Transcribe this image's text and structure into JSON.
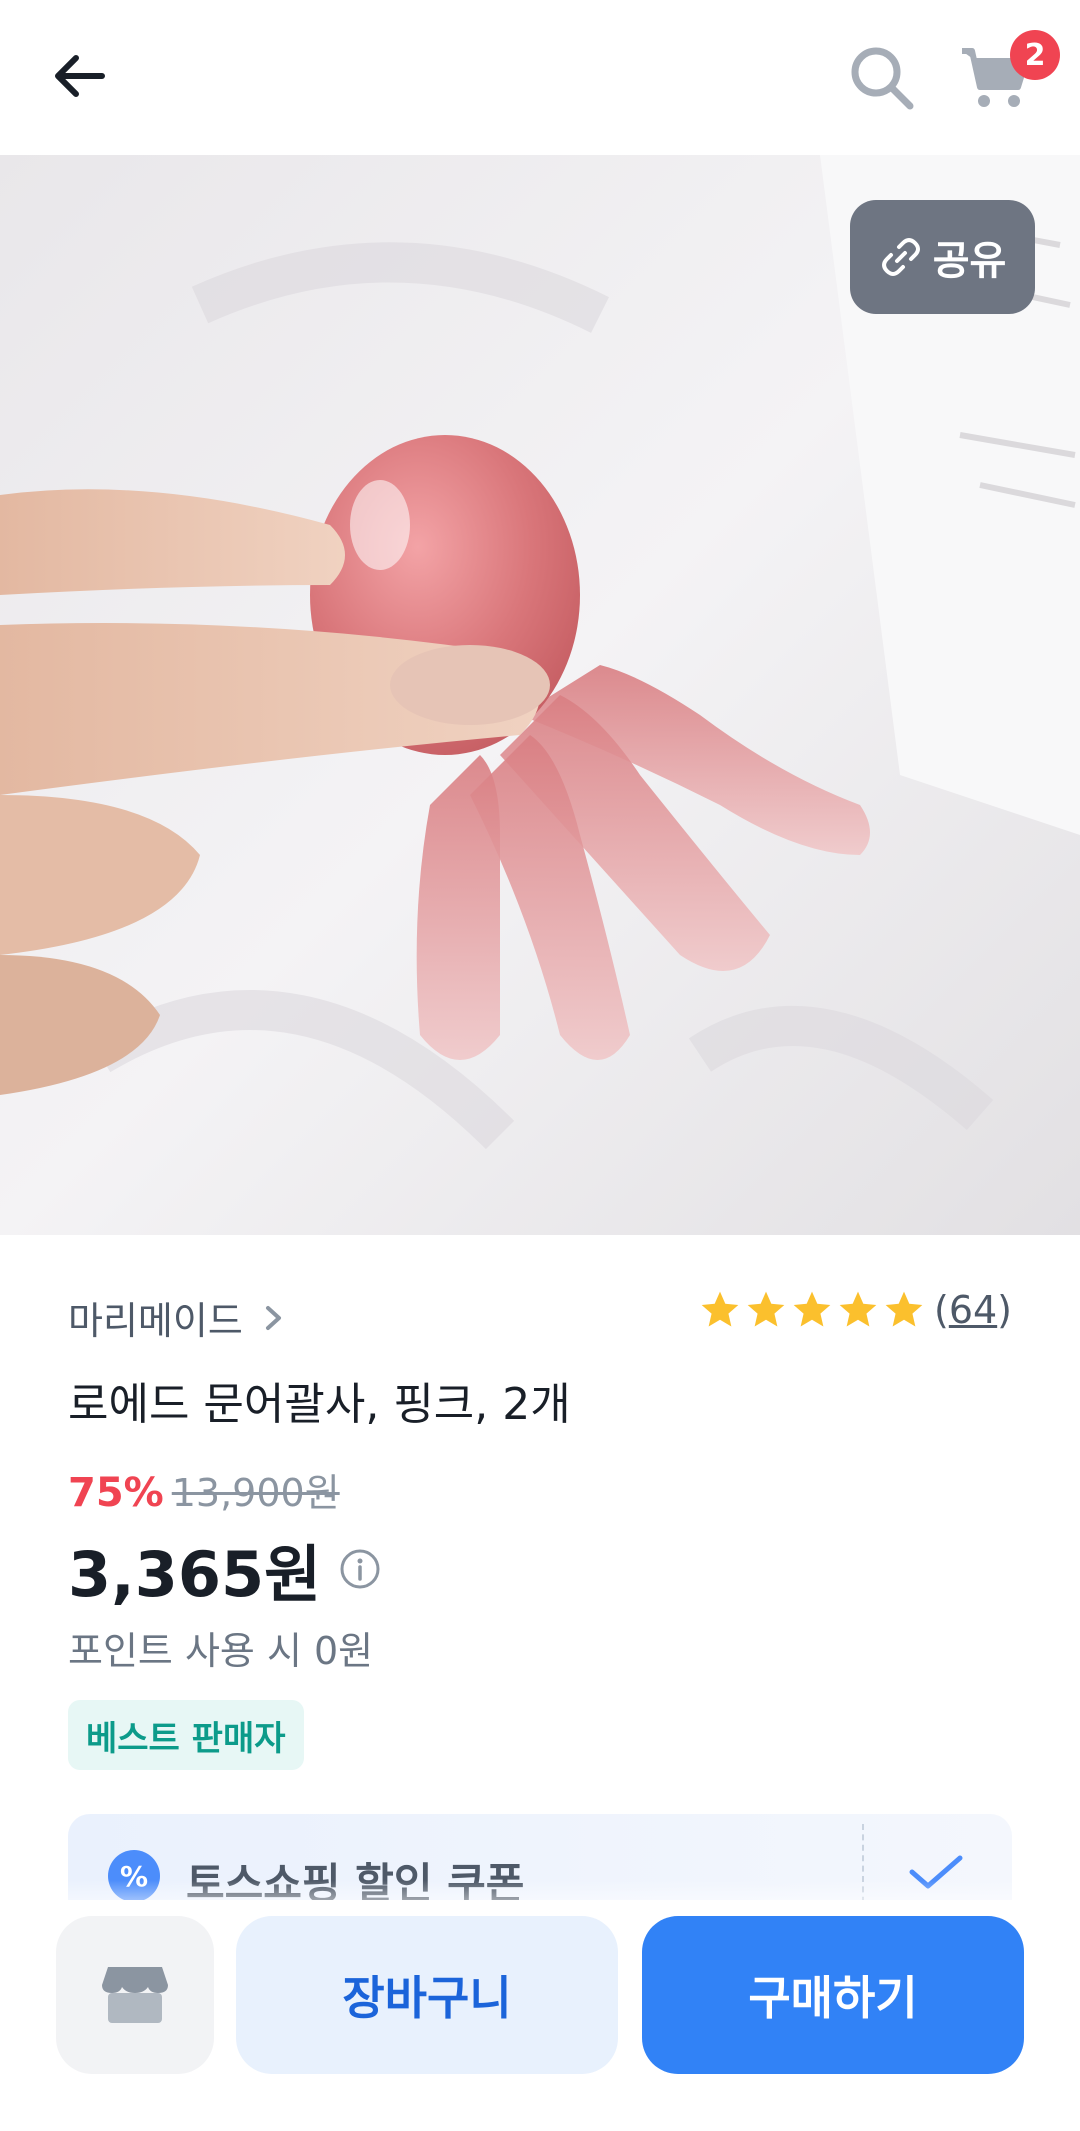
{
  "header": {
    "cart_count": "2"
  },
  "hero": {
    "share_label": "공유"
  },
  "product": {
    "seller": "마리메이드",
    "rating_stars": 5,
    "review_count_open": "(",
    "review_count": "64",
    "review_count_close": ")",
    "title": "로에드 문어괄사, 핑크, 2개",
    "discount": "75%",
    "original_price": "13,900원",
    "final_price": "3,365원",
    "point_text": "포인트 사용 시 0원",
    "badge": "베스트 판매자"
  },
  "coupon": {
    "icon_text": "%",
    "label": "토스쇼핑 할인 쿠폰"
  },
  "actions": {
    "cart_label": "장바구니",
    "buy_label": "구매하기"
  },
  "colors": {
    "accent": "#3182f6",
    "discount": "#f04452",
    "star": "#fbc02d"
  }
}
